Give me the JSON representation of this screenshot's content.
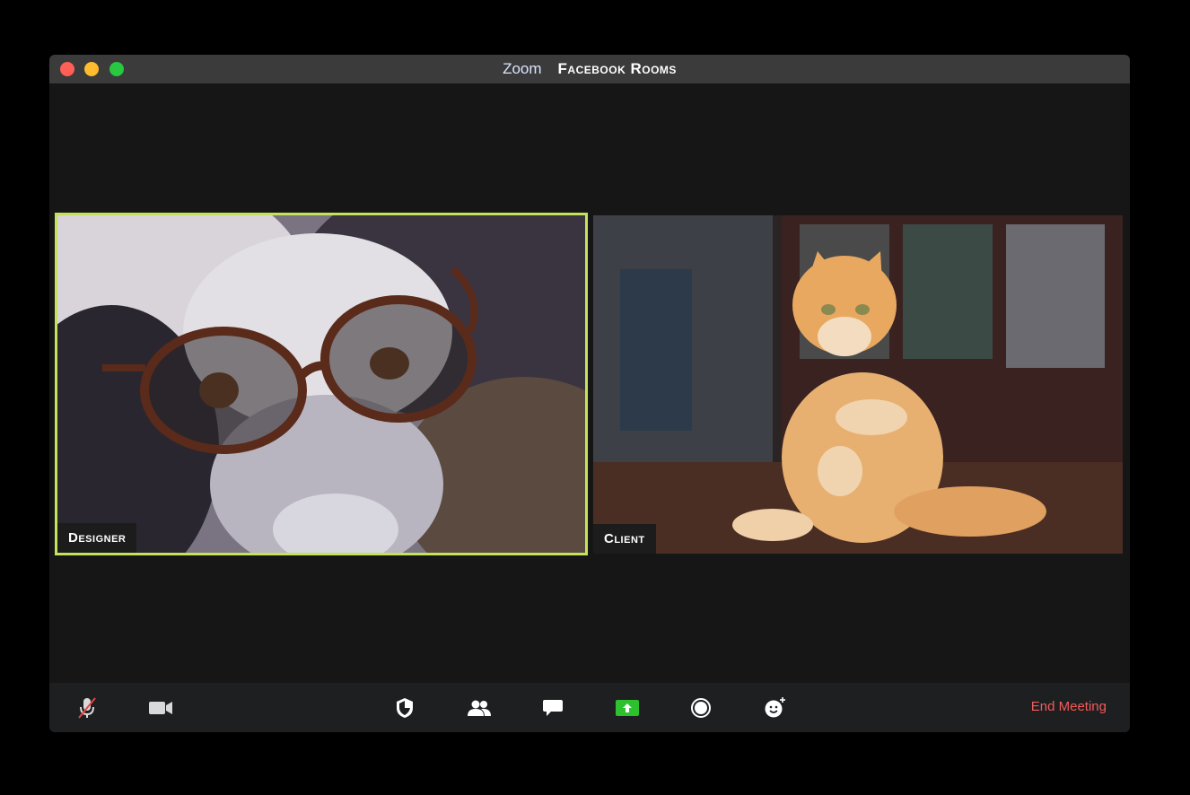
{
  "window": {
    "app_name": "Zoom",
    "room_name": "Facebook Rooms"
  },
  "participants": [
    {
      "name": "Designer",
      "active_speaker": true
    },
    {
      "name": "Client",
      "active_speaker": false
    }
  ],
  "toolbar": {
    "end_label": "End Meeting",
    "icons": [
      "mic-muted-icon",
      "video-camera-icon",
      "security-shield-icon",
      "participants-icon",
      "chat-icon",
      "share-screen-icon",
      "record-icon",
      "reactions-icon"
    ]
  },
  "colors": {
    "active_speaker_border": "#c4e35a",
    "share_button": "#2ec12e",
    "end_meeting": "#f25b5b"
  }
}
